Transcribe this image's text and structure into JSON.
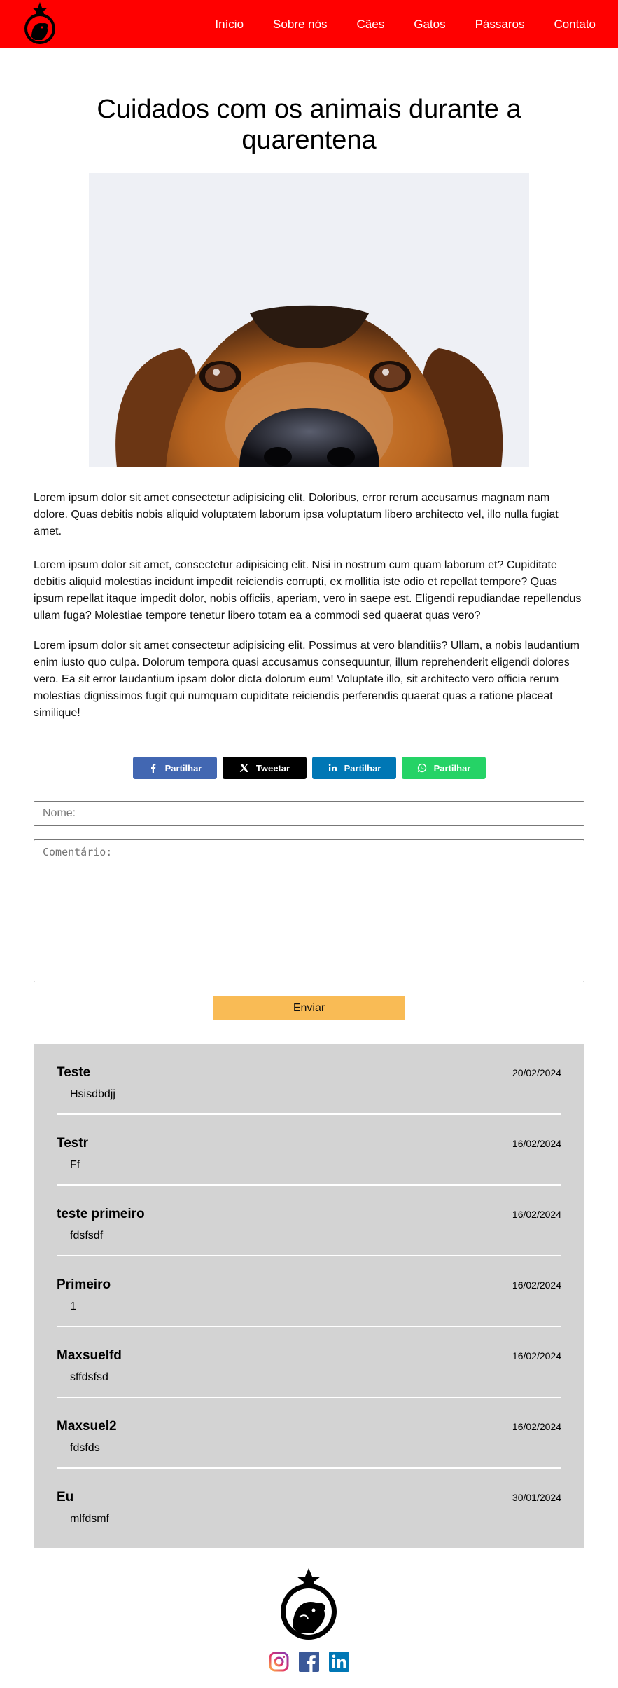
{
  "nav": {
    "items": [
      "Início",
      "Sobre nós",
      "Cães",
      "Gatos",
      "Pássaros",
      "Contato"
    ]
  },
  "article": {
    "title": "Cuidados com os animais durante a quarentena",
    "paragraphs": [
      "Lorem ipsum dolor sit amet consectetur adipisicing elit. Doloribus, error rerum accusamus magnam nam dolore. Quas debitis nobis aliquid voluptatem laborum ipsa voluptatum libero architecto vel, illo nulla fugiat amet.",
      "Lorem ipsum dolor sit amet, consectetur adipisicing elit. Nisi in nostrum cum quam laborum et? Cupiditate debitis aliquid molestias incidunt impedit reiciendis corrupti, ex mollitia iste odio et repellat tempore? Quas ipsum repellat itaque impedit dolor, nobis officiis, aperiam, vero in saepe est. Eligendi repudiandae repellendus ullam fuga? Molestiae tempore tenetur libero totam ea a commodi sed quaerat quas vero?",
      "Lorem ipsum dolor sit amet consectetur adipisicing elit. Possimus at vero blanditiis? Ullam, a nobis laudantium enim iusto quo culpa. Dolorum tempora quasi accusamus consequuntur, illum reprehenderit eligendi dolores vero. Ea sit error laudantium ipsam dolor dicta dolorum eum! Voluptate illo, sit architecto vero officia rerum molestias dignissimos fugit qui numquam cupiditate reiciendis perferendis quaerat quas a ratione placeat similique!"
    ]
  },
  "share": {
    "facebook": "Partilhar",
    "twitter": "Tweetar",
    "linkedin": "Partilhar",
    "whatsapp": "Partilhar",
    "colors": {
      "facebook": "#4267b2",
      "twitter": "#000000",
      "linkedin": "#0077b5",
      "whatsapp": "#25d366"
    }
  },
  "form": {
    "name_placeholder": "Nome:",
    "comment_placeholder": "Comentário:",
    "submit_label": "Enviar"
  },
  "comments": [
    {
      "author": "Teste",
      "date": "20/02/2024",
      "text": "Hsisdbdjj"
    },
    {
      "author": "Testr",
      "date": "16/02/2024",
      "text": "Ff"
    },
    {
      "author": "teste primeiro",
      "date": "16/02/2024",
      "text": "fdsfsdf"
    },
    {
      "author": "Primeiro",
      "date": "16/02/2024",
      "text": "1"
    },
    {
      "author": "Maxsuelfd",
      "date": "16/02/2024",
      "text": "sffdsfsd"
    },
    {
      "author": "Maxsuel2",
      "date": "16/02/2024",
      "text": "fdsfds"
    },
    {
      "author": "Eu",
      "date": "30/01/2024",
      "text": "mlfdsmf"
    }
  ],
  "footer": {
    "social_icons": [
      "instagram-icon",
      "facebook-icon",
      "linkedin-icon"
    ]
  },
  "colors": {
    "header": "#ff0000",
    "submit": "#f9bb55",
    "comments_bg": "#d3d3d3"
  }
}
